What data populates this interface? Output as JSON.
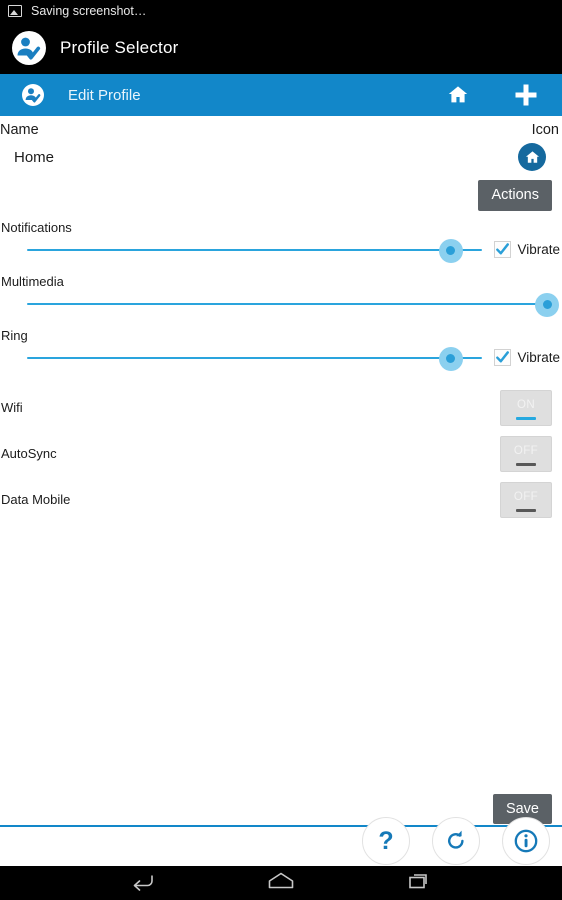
{
  "status": {
    "icon": "image-icon",
    "text": "Saving screenshot…"
  },
  "appbar": {
    "logo": "profile-selector-logo",
    "title": "Profile Selector"
  },
  "actionbar": {
    "icon": "profile-selector-icon",
    "title": "Edit Profile",
    "home_icon": "home-icon",
    "add_icon": "plus-icon",
    "background": "#1287c9"
  },
  "form": {
    "name_header": "Name",
    "icon_header": "Icon",
    "profile_name": "Home",
    "profile_icon": "home-icon",
    "actions_label": "Actions",
    "save_label": "Save"
  },
  "sliders": [
    {
      "label": "Notifications",
      "value": 93,
      "vibrate_label": "Vibrate",
      "vibrate_checked": true
    },
    {
      "label": "Multimedia",
      "value": 100,
      "vibrate_label": "",
      "vibrate_checked": null
    },
    {
      "label": "Ring",
      "value": 93,
      "vibrate_label": "Vibrate",
      "vibrate_checked": true
    }
  ],
  "toggles": [
    {
      "label": "Wifi",
      "state": "ON"
    },
    {
      "label": "AutoSync",
      "state": "OFF"
    },
    {
      "label": "Data Mobile",
      "state": "OFF"
    }
  ],
  "bottombar": {
    "help_label": "?",
    "reset_icon": "refresh-icon",
    "info_icon": "info-icon"
  },
  "navbar": {
    "back": "back-icon",
    "home": "home-icon",
    "recents": "recents-icon"
  },
  "colors": {
    "accent": "#1287c9",
    "slider": "#2aa4dd",
    "thumb": "#8bd0ef",
    "button_gray": "#5b6166"
  }
}
